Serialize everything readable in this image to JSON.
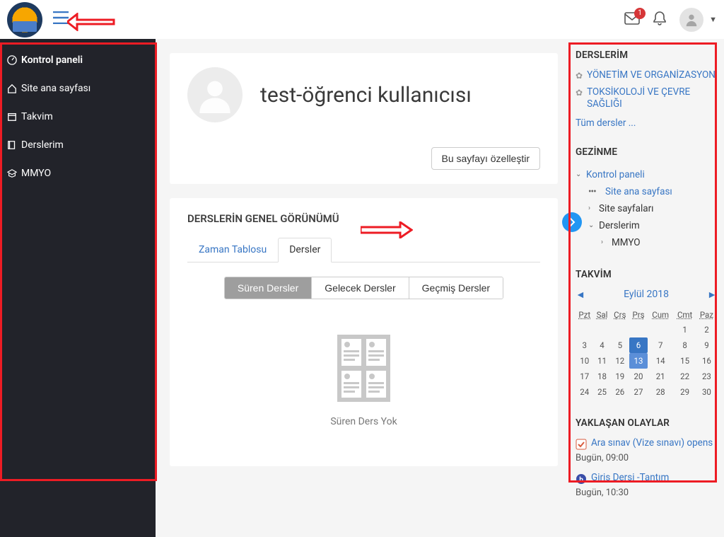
{
  "header": {
    "notif_count": "1"
  },
  "sidebar": {
    "items": [
      {
        "label": "Kontrol paneli"
      },
      {
        "label": "Site ana sayfası"
      },
      {
        "label": "Takvim"
      },
      {
        "label": "Derslerim"
      },
      {
        "label": "MMYO"
      }
    ]
  },
  "profile": {
    "title": "test-öğrenci kullanıcısı",
    "customize_btn": "Bu sayfayı özelleştir"
  },
  "courses_overview": {
    "title": "DERSLERİN GENEL GÖRÜNÜMÜ",
    "tabs": {
      "timeline": "Zaman Tablosu",
      "courses": "Dersler"
    },
    "filters": {
      "inprogress": "Süren Dersler",
      "future": "Gelecek Dersler",
      "past": "Geçmiş Dersler"
    },
    "empty_text": "Süren Ders Yok"
  },
  "right": {
    "my_courses": {
      "title": "DERSLERİM",
      "items": [
        {
          "label": "YÖNETİM VE ORGANİZASYON"
        },
        {
          "label": "TOKSİKOLOJİ VE ÇEVRE SAĞLIĞI"
        }
      ],
      "all_label": "Tüm dersler ..."
    },
    "nav": {
      "title": "GEZİNME",
      "dashboard": "Kontrol paneli",
      "home": "Site ana sayfası",
      "sitepages": "Site sayfaları",
      "mycourses": "Derslerim",
      "mmyo": "MMYO"
    },
    "calendar": {
      "title": "TAKVİM",
      "month": "Eylül 2018",
      "days": [
        "Pzt",
        "Sal",
        "Çrş",
        "Prş",
        "Cum",
        "Cmt",
        "Paz"
      ],
      "weeks": [
        [
          "",
          "",
          "",
          "",
          "",
          "1",
          "2"
        ],
        [
          "3",
          "4",
          "5",
          "6",
          "7",
          "8",
          "9"
        ],
        [
          "10",
          "11",
          "12",
          "13",
          "14",
          "15",
          "16"
        ],
        [
          "17",
          "18",
          "19",
          "20",
          "21",
          "22",
          "23"
        ],
        [
          "24",
          "25",
          "26",
          "27",
          "28",
          "29",
          "30"
        ]
      ],
      "today_cell": "6",
      "marked_cell": "13"
    },
    "upcoming": {
      "title": "YAKLAŞAN OLAYLAR",
      "events": [
        {
          "label": "Ara sınav (Vize sınavı) opens",
          "time": "Bugün, 09:00"
        },
        {
          "label": "Giriş Dersi -Tantım",
          "time": "Bugün, 10:30"
        }
      ]
    }
  }
}
